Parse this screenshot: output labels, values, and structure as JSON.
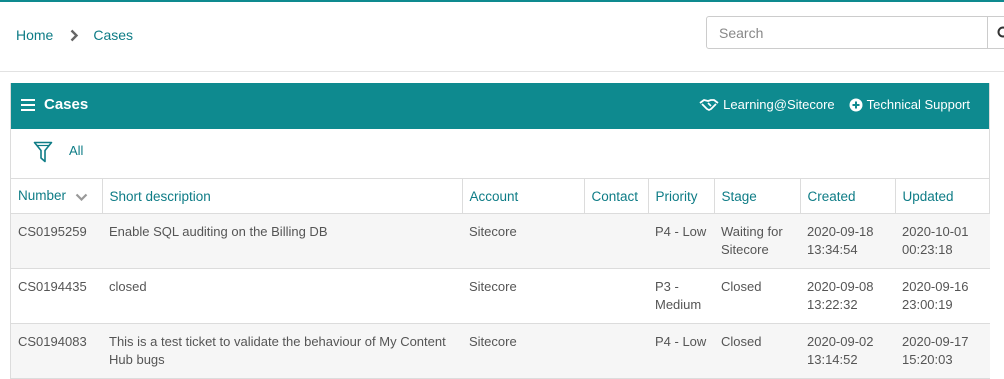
{
  "breadcrumb": {
    "home": "Home",
    "current": "Cases"
  },
  "search": {
    "placeholder": "Search",
    "value": ""
  },
  "panel": {
    "title": "Cases",
    "links": {
      "learning": "Learning@Sitecore",
      "support": "Technical Support"
    }
  },
  "filter": {
    "label": "All"
  },
  "table": {
    "columns": {
      "number": "Number",
      "short_description": "Short description",
      "account": "Account",
      "contact": "Contact",
      "priority": "Priority",
      "stage": "Stage",
      "created": "Created",
      "updated": "Updated"
    },
    "rows": [
      {
        "number": "CS0195259",
        "short_description": "Enable SQL auditing on the Billing DB",
        "account": "Sitecore",
        "contact": "",
        "priority": "P4 - Low",
        "stage": "Waiting for Sitecore",
        "created": "2020-09-18 13:34:54",
        "updated": "2020-10-01 00:23:18"
      },
      {
        "number": "CS0194435",
        "short_description": "closed",
        "account": "Sitecore",
        "contact": "",
        "priority": "P3 - Medium",
        "stage": "Closed",
        "created": "2020-09-08 13:22:32",
        "updated": "2020-09-16 23:00:19"
      },
      {
        "number": "CS0194083",
        "short_description": "This is a test ticket to validate the behaviour of My Content Hub bugs",
        "account": "Sitecore",
        "contact": "",
        "priority": "P4 - Low",
        "stage": "Closed",
        "created": "2020-09-02 13:14:52",
        "updated": "2020-09-17 15:20:03"
      }
    ]
  },
  "icons": {
    "breadcrumb_separator": "chevron-right-icon",
    "search": "search-icon",
    "menu": "hamburger-menu-icon",
    "learning": "handshake-icon",
    "support": "plus-circle-icon",
    "filter": "funnel-icon",
    "sort": "chevron-down-icon"
  },
  "colors": {
    "accent": "#0e8a8f",
    "link": "#0e7c86",
    "row_alt": "#f6f6f6"
  }
}
